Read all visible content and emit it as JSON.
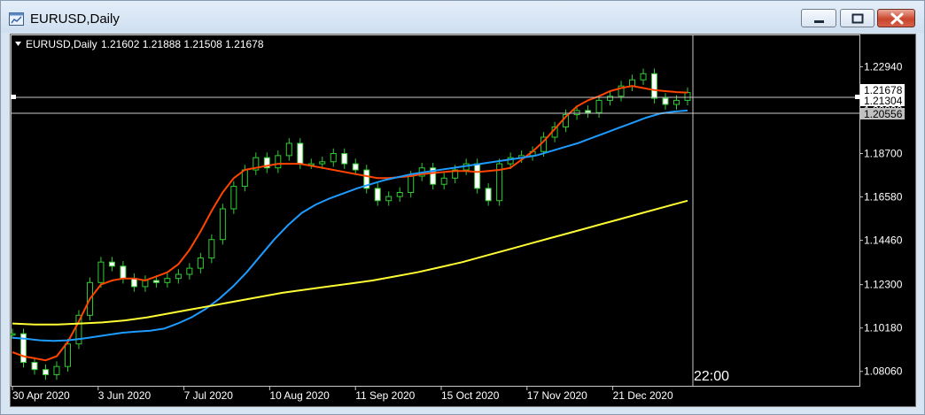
{
  "window": {
    "title": "EURUSD,Daily",
    "icon": "chart-window-icon",
    "buttons": [
      "minimize-icon",
      "maximize-icon",
      "close-icon"
    ]
  },
  "chart_header": {
    "symbol": "EURUSD,Daily",
    "ohlc": "1.21602 1.21888 1.21508 1.21678"
  },
  "chart_data": {
    "type": "candlestick",
    "symbol": "EURUSD",
    "timeframe": "Daily",
    "x_labels": [
      "30 Apr 2020",
      "3 Jun 2020",
      "7 Jul 2020",
      "10 Aug 2020",
      "11 Sep 2020",
      "15 Oct 2020",
      "17 Nov 2020",
      "21 Dec 2020"
    ],
    "y_ticks": [
      "1.22940",
      "1.20820",
      "1.18700",
      "1.16580",
      "1.14460",
      "1.12300",
      "1.10180",
      "1.08060"
    ],
    "ylim": [
      1.074,
      1.2365
    ],
    "price_tags": [
      {
        "label": "1.21678",
        "value": 1.21678,
        "style": "white"
      },
      {
        "label": "1.21304",
        "value": 1.21304,
        "style": "white"
      },
      {
        "label": "1.20556",
        "value": 1.20556,
        "style": "grey"
      }
    ],
    "crosshair": {
      "price": 1.20556,
      "time_label": "22:00"
    },
    "series": [
      {
        "kind": "close",
        "color": "#32cd32",
        "values": [
          1.099,
          1.085,
          1.0815,
          1.079,
          1.083,
          1.094,
          1.108,
          1.124,
          1.134,
          1.132,
          1.126,
          1.122,
          1.125,
          1.124,
          1.126,
          1.128,
          1.131,
          1.136,
          1.145,
          1.16,
          1.171,
          1.179,
          1.185,
          1.18,
          1.186,
          1.192,
          1.182,
          1.182,
          1.183,
          1.187,
          1.182,
          1.179,
          1.17,
          1.164,
          1.166,
          1.168,
          1.176,
          1.18,
          1.172,
          1.175,
          1.179,
          1.182,
          1.17,
          1.164,
          1.182,
          1.185,
          1.186,
          1.188,
          1.195,
          1.2,
          1.206,
          1.208,
          1.207,
          1.213,
          1.215,
          1.22,
          1.223,
          1.226,
          1.214,
          1.211,
          1.213,
          1.2168
        ]
      },
      {
        "kind": "ma",
        "color": "#ff4500",
        "values": [
          1.09,
          1.088,
          1.087,
          1.086,
          1.088,
          1.095,
          1.105,
          1.116,
          1.123,
          1.125,
          1.126,
          1.126,
          1.125,
          1.127,
          1.129,
          1.133,
          1.14,
          1.149,
          1.159,
          1.168,
          1.175,
          1.179,
          1.18,
          1.181,
          1.182,
          1.182,
          1.182,
          1.181,
          1.18,
          1.179,
          1.178,
          1.177,
          1.176,
          1.175,
          1.175,
          1.1755,
          1.176,
          1.177,
          1.1775,
          1.178,
          1.1785,
          1.1785,
          1.178,
          1.1785,
          1.179,
          1.18,
          1.184,
          1.188,
          1.193,
          1.199,
          1.205,
          1.21,
          1.213,
          1.215,
          1.2175,
          1.219,
          1.22,
          1.219,
          1.218,
          1.2175,
          1.217,
          1.2168
        ]
      },
      {
        "kind": "ma",
        "color": "#1e9bff",
        "values": [
          1.097,
          1.0965,
          1.0958,
          1.0955,
          1.0958,
          1.0965,
          1.0975,
          1.0985,
          1.0995,
          1.1,
          1.1005,
          1.1015,
          1.104,
          1.107,
          1.111,
          1.116,
          1.122,
          1.129,
          1.137,
          1.145,
          1.152,
          1.158,
          1.162,
          1.165,
          1.1675,
          1.17,
          1.172,
          1.174,
          1.1755,
          1.177,
          1.178,
          1.179,
          1.18,
          1.181,
          1.182,
          1.183,
          1.184,
          1.185,
          1.186,
          1.188,
          1.19,
          1.192,
          1.1945,
          1.197,
          1.1995,
          1.202,
          1.2045,
          1.2065,
          1.2075,
          1.208
        ]
      },
      {
        "kind": "ma",
        "color": "#ffff33",
        "values": [
          1.104,
          1.1035,
          1.1035,
          1.104,
          1.1045,
          1.1055,
          1.107,
          1.109,
          1.111,
          1.113,
          1.115,
          1.117,
          1.119,
          1.1205,
          1.122,
          1.1235,
          1.125,
          1.127,
          1.129,
          1.1315,
          1.134,
          1.137,
          1.14,
          1.143,
          1.146,
          1.149,
          1.152,
          1.155,
          1.158,
          1.161,
          1.164
        ]
      }
    ]
  }
}
